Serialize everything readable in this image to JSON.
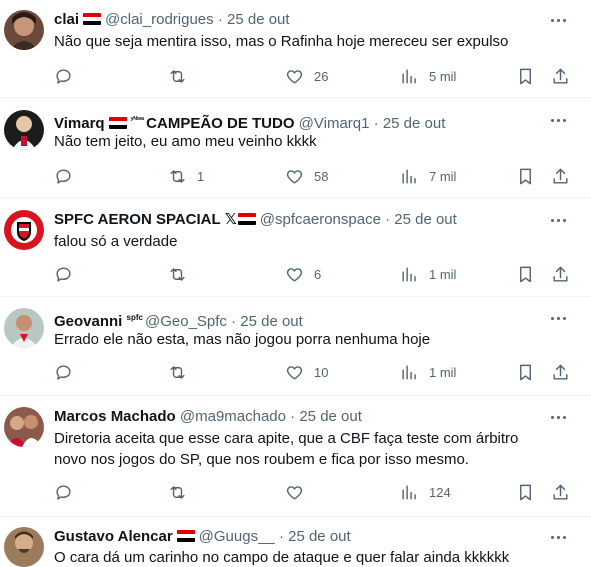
{
  "tweets": [
    {
      "name": "clai",
      "badge": "",
      "suffix": "",
      "handle": "@clai_rodrigues",
      "date": "25 de out",
      "text": "Não que seja mentira isso, mas o Rafinha hoje mereceu ser expulso",
      "replies": "",
      "retweets": "",
      "likes": "26",
      "views": "5 mil"
    },
    {
      "name": "Vimarq",
      "badge": "ʸᴺʷᵃ",
      "suffix": "CAMPEÃO DE TUDO",
      "handle": "@Vimarq1",
      "date": "25 de out",
      "text": "Não tem jeito, eu amo meu veinho kkkk",
      "replies": "",
      "retweets": "1",
      "likes": "58",
      "views": "7 mil"
    },
    {
      "name": "SPFC AERON SPACIAL",
      "badge": "",
      "suffix": "",
      "handle": "@spfcaeronspace",
      "date": "25 de out",
      "text": "falou só a verdade",
      "replies": "",
      "retweets": "",
      "likes": "6",
      "views": "1 mil"
    },
    {
      "name": "Geovanni",
      "badge": "spfc",
      "suffix": "",
      "handle": "@Geo_Spfc",
      "date": "25 de out",
      "text": "Errado ele não esta, mas não jogou porra nenhuma hoje",
      "replies": "",
      "retweets": "",
      "likes": "10",
      "views": "1 mil"
    },
    {
      "name": "Marcos Machado",
      "badge": "",
      "suffix": "",
      "handle": "@ma9machado",
      "date": "25 de out",
      "text": "Diretoria aceita que esse cara apite, que a CBF faça teste com árbitro novo nos jogos do SP, que nos roubem e fica por isso mesmo.",
      "replies": "",
      "retweets": "",
      "likes": "",
      "views": "124"
    },
    {
      "name": "Gustavo Alencar",
      "badge": "",
      "suffix": "",
      "handle": "@Guugs__",
      "date": "25 de out",
      "text": "O cara dá um carinho no campo de ataque e quer falar ainda kkkkkk",
      "replies": "",
      "retweets": "",
      "likes": "",
      "views": ""
    }
  ],
  "colors": {
    "text": "#0f1419",
    "muted": "#536471",
    "divider": "#eff3f4",
    "flag_red": "#e00000",
    "flag_white": "#ffffff",
    "flag_black": "#000000"
  },
  "separator_dot": "·"
}
